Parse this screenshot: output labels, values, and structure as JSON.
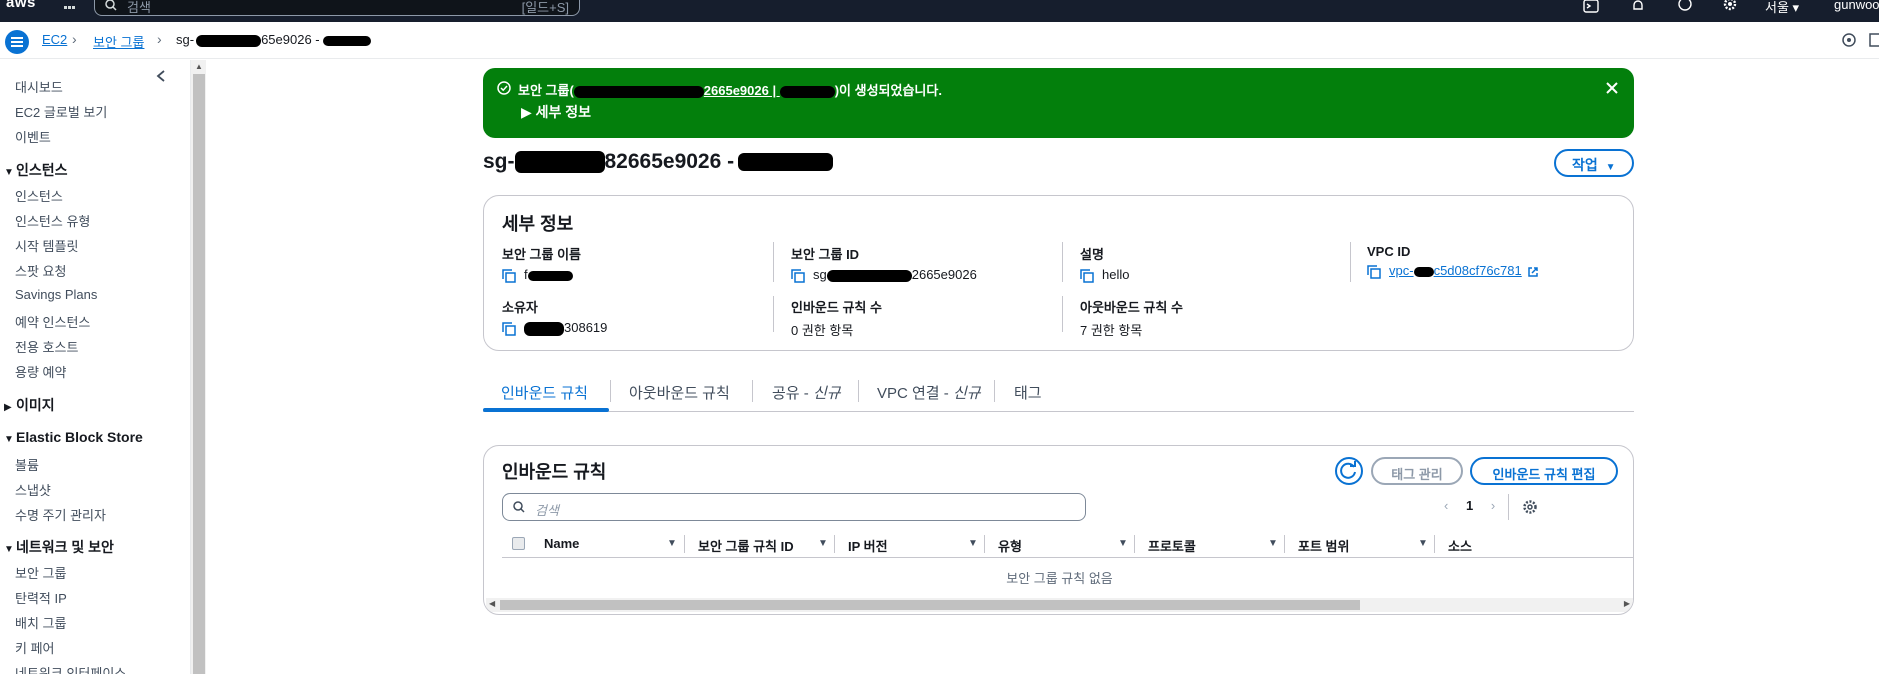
{
  "topbar": {
    "logo": "aws",
    "search_placeholder": "검색",
    "search_shortcut": "[일드+S]",
    "icons": [
      "cloudshell-icon",
      "bell-icon",
      "help-icon",
      "gear-icon"
    ],
    "region": "서울 ▾",
    "user": "gunwoo"
  },
  "breadcrumb": {
    "items": [
      "EC2",
      "보안 그룹"
    ],
    "current": "sg-"
  },
  "sidebar": {
    "top_items": [
      "대시보드",
      "EC2 글로벌 보기",
      "이벤트"
    ],
    "sections": [
      {
        "title": "인스턴스",
        "expanded": true,
        "items": [
          "인스턴스",
          "인스턴스 유형",
          "시작 템플릿",
          "스팟 요청",
          "Savings Plans",
          "예약 인스턴스",
          "전용 호스트",
          "용량 예약"
        ]
      },
      {
        "title": "이미지",
        "expanded": false,
        "items": []
      },
      {
        "title": "Elastic Block Store",
        "expanded": true,
        "items": [
          "볼륨",
          "스냅샷",
          "수명 주기 관리자"
        ]
      },
      {
        "title": "네트워크 및 보안",
        "expanded": true,
        "items": [
          "보안 그룹",
          "탄력적 IP",
          "배치 그룹",
          "키 페어",
          "네트워크 인터페이스"
        ]
      }
    ]
  },
  "flash": {
    "prefix": "보안 그룹(",
    "id_tail": "2665e9026 | ",
    "suffix": ")이 생성되었습니다.",
    "details_label": "▶ 세부 정보",
    "color": "#037f0c"
  },
  "page": {
    "title_prefix": "sg-",
    "title_mid": "82665e9026 -",
    "action_button": "작업"
  },
  "details": {
    "heading": "세부 정보",
    "fields": {
      "sg_name_label": "보안 그룹 이름",
      "sg_name_value": "f",
      "sg_id_label": "보안 그룹 ID",
      "sg_id_value_prefix": "sg",
      "sg_id_value_suffix": "2665e9026",
      "description_label": "설명",
      "description_value": "hello",
      "vpc_label": "VPC ID",
      "vpc_value_prefix": "vpc-",
      "vpc_value_suffix": "c5d08cf76c781",
      "owner_label": "소유자",
      "owner_value_suffix": "308619",
      "inbound_count_label": "인바운드 규칙 수",
      "inbound_count_value": "0 권한 항목",
      "outbound_count_label": "아웃바운드 규칙 수",
      "outbound_count_value": "7 권한 항목"
    }
  },
  "tabs": [
    {
      "label": "인바운드 규칙",
      "active": true
    },
    {
      "label": "아웃바운드 규칙",
      "active": false
    },
    {
      "label": "공유 - ",
      "suffix": "신규",
      "active": false
    },
    {
      "label": "VPC 연결 - ",
      "suffix": "신규",
      "active": false
    },
    {
      "label": "태그",
      "active": false
    }
  ],
  "rules": {
    "heading": "인바운드 규칙",
    "tag_button": "태그 관리",
    "edit_button": "인바운드 규칙 편집",
    "search_placeholder": "검색",
    "page": "1",
    "columns": [
      "Name",
      "보안 그룹 규칙 ID",
      "IP 버전",
      "유형",
      "프로토콜",
      "포트 범위",
      "소스"
    ],
    "empty_text": "보안 그룹 규칙 없음"
  },
  "colors": {
    "accent": "#0972d3",
    "nav_bg": "#161e2d",
    "success": "#037f0c"
  }
}
